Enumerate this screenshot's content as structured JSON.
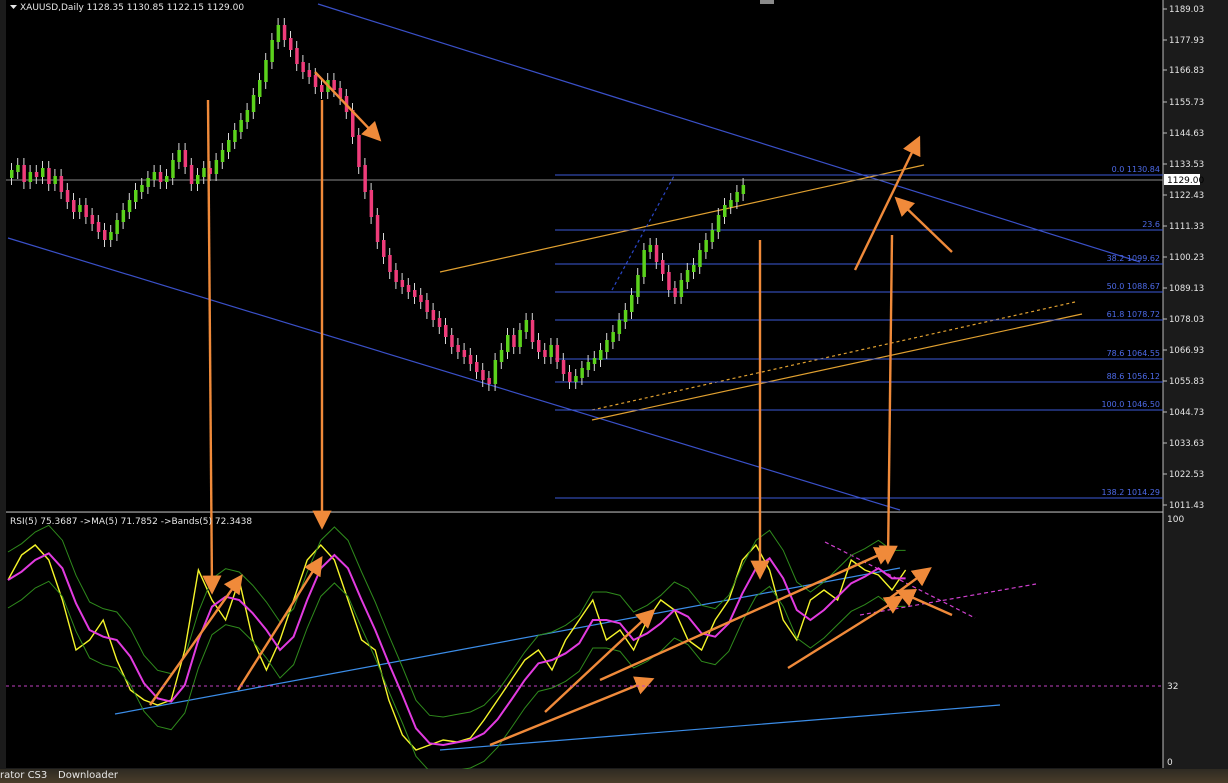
{
  "header": {
    "dropdown_icon": "triangle-down-icon",
    "symbol_info": "XAUUSD,Daily  1128.35 1130.85 1122.15 1129.00"
  },
  "price_axis": {
    "ticks": [
      "1189.03",
      "1177.93",
      "1166.83",
      "1155.73",
      "1144.63",
      "1133.53",
      "1122.43",
      "1111.33",
      "1100.23",
      "1089.13",
      "1078.03",
      "1066.93",
      "1055.83",
      "1044.73",
      "1033.63",
      "1022.53",
      "1011.43"
    ],
    "current_price": "1129.00",
    "current_bg": "#ffffff"
  },
  "fibonacci": {
    "color": "#3c5ad8",
    "levels": [
      "0.0 1130.84",
      "23.6",
      "38.2 1099.62",
      "50.0 1088.67",
      "61.8 1078.72",
      "78.6 1064.55",
      "88.6 1056.12",
      "100.0 1046.50",
      "138.2 1014.29"
    ]
  },
  "rsi_panel": {
    "legend": "RSI(5) 75.3687  ->MA(5) 71.7852  ->Bands(5) 72.3438",
    "axis_ticks": [
      "100",
      "32",
      "0"
    ]
  },
  "colors": {
    "bull": "#5bd21c",
    "bear": "#ee3c7a",
    "rsi": "#f5f52a",
    "ma": "#e23be0",
    "bands": "#2f8a1c",
    "arrow": "#f08a3a",
    "channel": "#3a50c8",
    "trend": "#e0a030"
  },
  "taskbar": {
    "item1": "rator CS3",
    "item2": "Downloader"
  }
}
